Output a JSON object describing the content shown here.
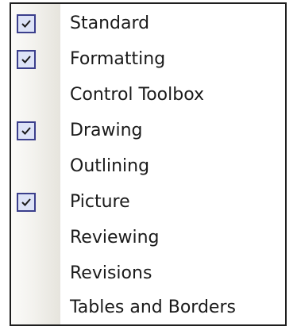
{
  "toolbar_menu": {
    "items": [
      {
        "label": "Standard",
        "checked": true
      },
      {
        "label": "Formatting",
        "checked": true
      },
      {
        "label": "Control Toolbox",
        "checked": false
      },
      {
        "label": "Drawing",
        "checked": true
      },
      {
        "label": "Outlining",
        "checked": false
      },
      {
        "label": "Picture",
        "checked": true
      },
      {
        "label": "Reviewing",
        "checked": false
      },
      {
        "label": "Revisions",
        "checked": false
      },
      {
        "label": "Tables and Borders",
        "checked": false
      }
    ]
  }
}
